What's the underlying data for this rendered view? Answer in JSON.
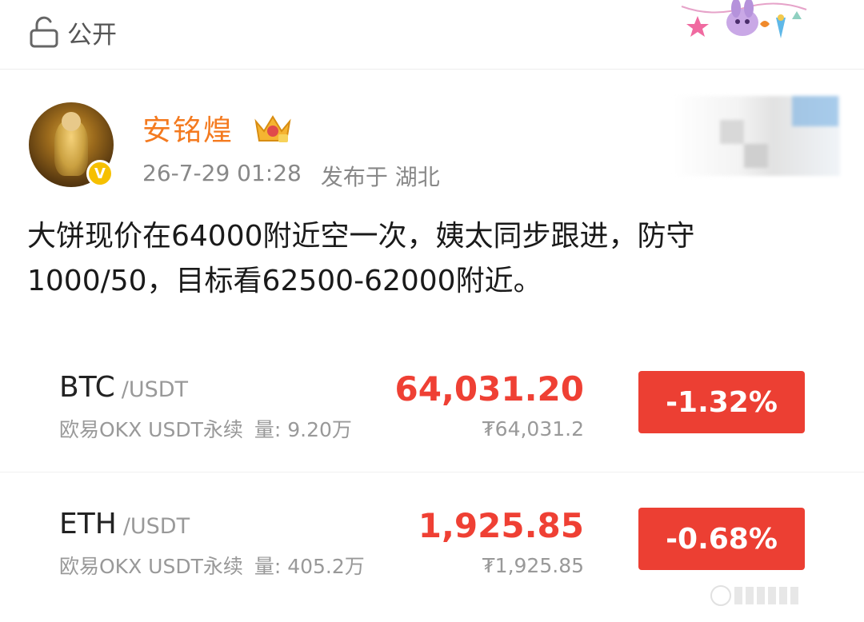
{
  "visibility": {
    "label": "公开",
    "icon": "lock-open-icon"
  },
  "author": {
    "name": "安铭煌",
    "badge_icon": "crown-badge-icon",
    "verified_icon": "verified-v-icon",
    "verified_text": "V",
    "timestamp": "26-7-29 01:28",
    "location": "发布于 湖北"
  },
  "post": {
    "line1": "大饼现价在64000附近空一次，姨太同步跟进，防守",
    "line2": "1000/50，目标看62500-62000附近。"
  },
  "quotes": [
    {
      "base": "BTC",
      "quote": "/USDT",
      "exchange": "欧易OKX USDT永续",
      "volume": "量: 9.20万",
      "price": "64,031.20",
      "price_sub": "₮64,031.2",
      "change": "-1.32%"
    },
    {
      "base": "ETH",
      "quote": "/USDT",
      "exchange": "欧易OKX USDT永续",
      "volume": "量: 405.2万",
      "price": "1,925.85",
      "price_sub": "₮1,925.85",
      "change": "-0.68%"
    }
  ],
  "colors": {
    "username": "#f47a1f",
    "price_down": "#ef4034",
    "change_bg": "#ec3f33",
    "verified": "#f6c000"
  }
}
